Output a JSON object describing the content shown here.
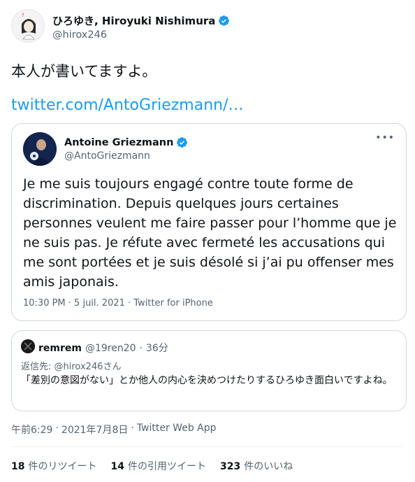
{
  "tweet": {
    "author": {
      "display_name": "ひろゆき, Hiroyuki Nishimura",
      "handle": "@hirox246",
      "verified_icon": "verified-badge-icon"
    },
    "text": "本人が書いてますよ。",
    "link": "twitter.com/AntoGriezmann/…"
  },
  "quoted_tweet": {
    "author": {
      "display_name": "Antoine Griezmann",
      "handle": "@AntoGriezmann",
      "verified_icon": "verified-badge-icon"
    },
    "more_label": "•••",
    "text": "Je me suis toujours engagé contre toute forme de discrimination. Depuis quelques jours certaines personnes veulent me faire passer pour l’homme que je ne suis pas. Je réfute avec fermeté les accusations qui me sont portées et je suis désolé si j’ai pu offenser mes amis japonais.",
    "meta": "10:30 PM · 5 juil. 2021 · Twitter for iPhone"
  },
  "reply_card": {
    "author": {
      "display_name": "remrem",
      "handle": "@19ren20",
      "separator": "·",
      "time": "36分"
    },
    "replying_to": "返信先: @hirox246さん",
    "text": "「差別の意図がない」とか他人の内心を決めつけたりするひろゆき面白いですよね。"
  },
  "timestamp": {
    "time": "午前6:29",
    "separator": "·",
    "date": "2021年7月8日",
    "source_sep": "·",
    "source": "Twitter Web App"
  },
  "stats": {
    "retweets": {
      "count": "18",
      "label": "件のリツイート"
    },
    "quotes": {
      "count": "14",
      "label": "件の引用ツイート"
    },
    "likes": {
      "count": "323",
      "label": "件のいいね"
    }
  },
  "colors": {
    "link": "#1d9bf0",
    "secondary_text": "#536471",
    "border": "#cfd9de",
    "verified": "#1d9bf0"
  }
}
